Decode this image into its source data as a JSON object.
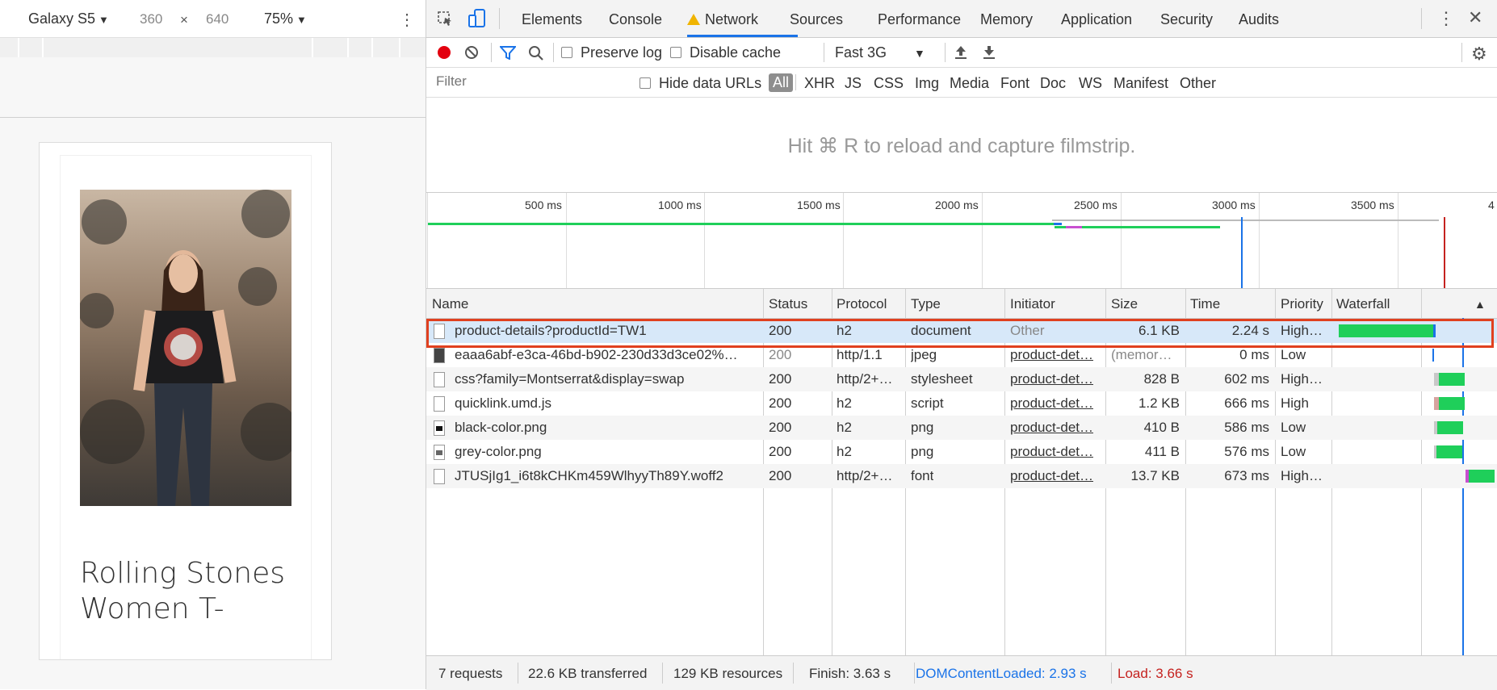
{
  "device": {
    "name": "Galaxy S5",
    "width": "360",
    "times": "×",
    "height": "640",
    "zoom": "75%",
    "product_title": "Rolling Stones Women T-"
  },
  "tabs": [
    "Elements",
    "Console",
    "Network",
    "Sources",
    "Performance",
    "Memory",
    "Application",
    "Security",
    "Audits"
  ],
  "toolbar": {
    "preserve_log": "Preserve log",
    "disable_cache": "Disable cache",
    "throttle": "Fast 3G"
  },
  "filter": {
    "placeholder": "Filter",
    "hide_data_urls": "Hide data URLs",
    "types": [
      "All",
      "XHR",
      "JS",
      "CSS",
      "Img",
      "Media",
      "Font",
      "Doc",
      "WS",
      "Manifest",
      "Other"
    ]
  },
  "filmstrip_message": "Hit ⌘ R to reload and capture filmstrip.",
  "overview_ticks": [
    "500 ms",
    "1000 ms",
    "1500 ms",
    "2000 ms",
    "2500 ms",
    "3000 ms",
    "3500 ms",
    "4"
  ],
  "columns": [
    "Name",
    "Status",
    "Protocol",
    "Type",
    "Initiator",
    "Size",
    "Time",
    "Priority",
    "Waterfall"
  ],
  "sort_indicator": "▲",
  "requests": [
    {
      "name": "product-details?productId=TW1",
      "status": "200",
      "protocol": "h2",
      "type": "document",
      "initiator": "Other",
      "size": "6.1 KB",
      "time": "2.24 s",
      "priority": "High…",
      "icon": "document"
    },
    {
      "name": "eaaa6abf-e3ca-46bd-b902-230d33d3ce02%…",
      "status": "200",
      "protocol": "http/1.1",
      "type": "jpeg",
      "initiator": "product-det…",
      "size": "(memor…",
      "time": "0 ms",
      "priority": "Low",
      "icon": "image"
    },
    {
      "name": "css?family=Montserrat&display=swap",
      "status": "200",
      "protocol": "http/2+…",
      "type": "stylesheet",
      "initiator": "product-det…",
      "size": "828 B",
      "time": "602 ms",
      "priority": "High…",
      "icon": "document"
    },
    {
      "name": "quicklink.umd.js",
      "status": "200",
      "protocol": "h2",
      "type": "script",
      "initiator": "product-det…",
      "size": "1.2 KB",
      "time": "666 ms",
      "priority": "High",
      "icon": "document"
    },
    {
      "name": "black-color.png",
      "status": "200",
      "protocol": "h2",
      "type": "png",
      "initiator": "product-det…",
      "size": "410 B",
      "time": "586 ms",
      "priority": "Low",
      "icon": "black-swatch"
    },
    {
      "name": "grey-color.png",
      "status": "200",
      "protocol": "h2",
      "type": "png",
      "initiator": "product-det…",
      "size": "411 B",
      "time": "576 ms",
      "priority": "Low",
      "icon": "grey-swatch"
    },
    {
      "name": "JTUSjIg1_i6t8kCHKm459WlhyyTh89Y.woff2",
      "status": "200",
      "protocol": "http/2+…",
      "type": "font",
      "initiator": "product-det…",
      "size": "13.7 KB",
      "time": "673 ms",
      "priority": "High…",
      "icon": "document"
    }
  ],
  "status": {
    "requests": "7 requests",
    "transferred": "22.6 KB transferred",
    "resources": "129 KB resources",
    "finish": "Finish: 3.63 s",
    "dcl": "DOMContentLoaded: 2.93 s",
    "load": "Load: 3.66 s"
  },
  "colors": {
    "accent": "#1a73e8",
    "record": "#e3000f",
    "waterfall": "#1fcf5a",
    "dcl": "#1a73e8",
    "load": "#c5221f",
    "selection_outline": "#e0401f"
  }
}
